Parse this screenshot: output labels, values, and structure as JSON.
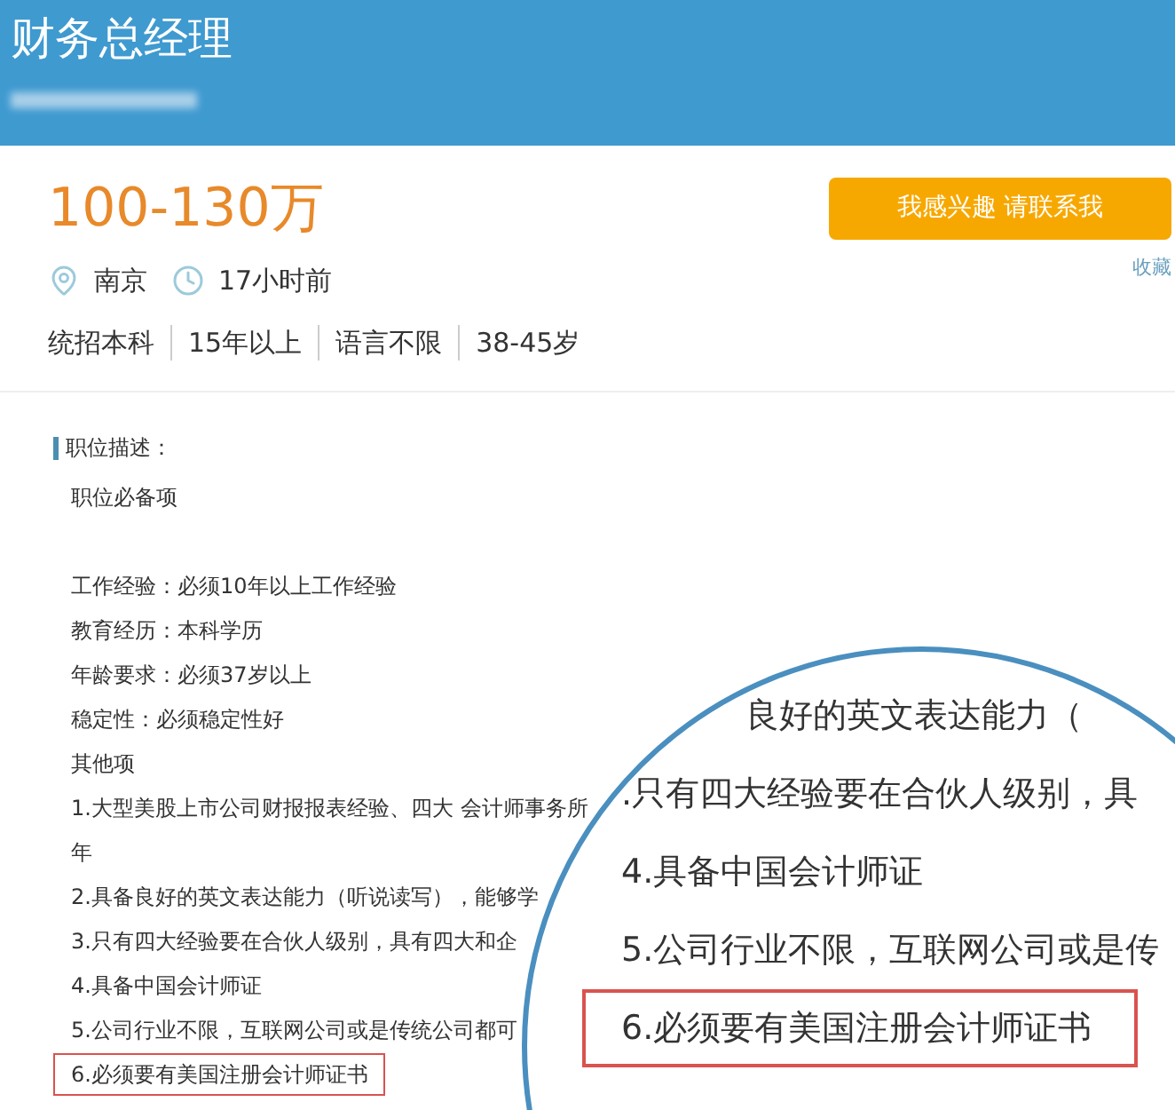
{
  "header": {
    "title": "财务总经理"
  },
  "salary": "100-130万",
  "apply_button": "我感兴趣 请联系我",
  "favorite_link": "收藏",
  "location": "南京",
  "posted": "17小时前",
  "tags": [
    "统招本科",
    "15年以上",
    "语言不限",
    "38-45岁"
  ],
  "description": {
    "title": "职位描述：",
    "intro": "职位必备项",
    "lines": [
      {
        "text": "工作经验：必须10年以上工作经验",
        "highlighted": false
      },
      {
        "text": "教育经历：本科学历",
        "highlighted": false
      },
      {
        "text": "年龄要求：必须37岁以上",
        "highlighted": false
      },
      {
        "text": "稳定性：必须稳定性好",
        "highlighted": false
      },
      {
        "text": "其他项",
        "highlighted": false
      },
      {
        "text": "1.大型美股上市公司财报报表经验、四大 会计师事务所",
        "highlighted": false
      },
      {
        "text": "年",
        "highlighted": false
      },
      {
        "text": "2.具备良好的英文表达能力（听说读写），能够学",
        "highlighted": false
      },
      {
        "text": "3.只有四大经验要在合伙人级别，具有四大和企",
        "highlighted": false
      },
      {
        "text": "4.具备中国会计师证",
        "highlighted": false
      },
      {
        "text": "5.公司行业不限，互联网公司或是传统公司都可",
        "highlighted": false
      },
      {
        "text": "6.必须要有美国注册会计师证书",
        "highlighted": true
      }
    ]
  },
  "magnifier": {
    "lines": [
      {
        "text": "良好的英文表达能力（",
        "highlighted": false
      },
      {
        "text": ".只有四大经验要在合伙人级别，具",
        "highlighted": false
      },
      {
        "text": "4.具备中国会计师证",
        "highlighted": false
      },
      {
        "text": "5.公司行业不限，互联网公司或是传",
        "highlighted": false
      },
      {
        "text": "6.必须要有美国注册会计师证书",
        "highlighted": true
      }
    ]
  }
}
